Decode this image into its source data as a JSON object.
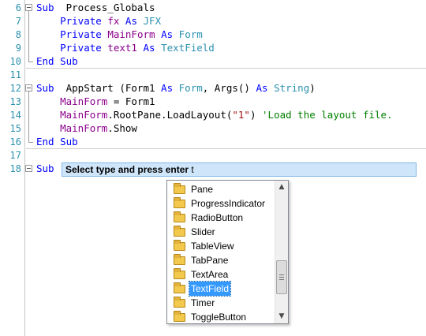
{
  "editor": {
    "lines": [
      {
        "num": "6",
        "tokens": [
          [
            "kw",
            "Sub"
          ],
          [
            "",
            "  Process_Globals"
          ]
        ]
      },
      {
        "num": "7",
        "tokens": [
          [
            "",
            "    "
          ],
          [
            "kw",
            "Private"
          ],
          [
            "",
            " "
          ],
          [
            "mf",
            "fx"
          ],
          [
            "",
            " "
          ],
          [
            "kw",
            "As"
          ],
          [
            "",
            " "
          ],
          [
            "tp",
            "JFX"
          ]
        ]
      },
      {
        "num": "8",
        "tokens": [
          [
            "",
            "    "
          ],
          [
            "kw",
            "Private"
          ],
          [
            "",
            " "
          ],
          [
            "mf",
            "MainForm"
          ],
          [
            "",
            " "
          ],
          [
            "kw",
            "As"
          ],
          [
            "",
            " "
          ],
          [
            "tp",
            "Form"
          ]
        ]
      },
      {
        "num": "9",
        "tokens": [
          [
            "",
            "    "
          ],
          [
            "kw",
            "Private"
          ],
          [
            "",
            " "
          ],
          [
            "mf",
            "text1"
          ],
          [
            "",
            " "
          ],
          [
            "kw",
            "As"
          ],
          [
            "",
            " "
          ],
          [
            "tp",
            "TextField"
          ]
        ]
      },
      {
        "num": "10",
        "tokens": [
          [
            "kw",
            "End Sub"
          ]
        ]
      },
      {
        "num": "11",
        "tokens": []
      },
      {
        "num": "12",
        "tokens": [
          [
            "kw",
            "Sub"
          ],
          [
            "",
            "  AppStart (Form1 "
          ],
          [
            "kw",
            "As"
          ],
          [
            "",
            " "
          ],
          [
            "tp",
            "Form"
          ],
          [
            "",
            ", Args() "
          ],
          [
            "kw",
            "As"
          ],
          [
            "",
            " "
          ],
          [
            "tp",
            "String"
          ],
          [
            "",
            ")"
          ]
        ]
      },
      {
        "num": "13",
        "tokens": [
          [
            "",
            "    "
          ],
          [
            "mf",
            "MainForm"
          ],
          [
            "",
            " = Form1"
          ]
        ]
      },
      {
        "num": "14",
        "tokens": [
          [
            "",
            "    "
          ],
          [
            "mf",
            "MainForm"
          ],
          [
            "",
            ".RootPane.LoadLayout("
          ],
          [
            "str",
            "\"1\""
          ],
          [
            "",
            ") "
          ],
          [
            "cm",
            "'Load the layout file."
          ]
        ]
      },
      {
        "num": "15",
        "tokens": [
          [
            "",
            "    "
          ],
          [
            "mf",
            "MainForm"
          ],
          [
            "",
            ".Show"
          ]
        ]
      },
      {
        "num": "16",
        "tokens": [
          [
            "kw",
            "End Sub"
          ]
        ]
      },
      {
        "num": "17",
        "tokens": []
      },
      {
        "num": "18",
        "tokens": [
          [
            "kw",
            "Sub"
          ]
        ]
      }
    ]
  },
  "prompt": {
    "hint": "Select type and press enter",
    "typed": " t"
  },
  "autocomplete": {
    "items": [
      "Pane",
      "ProgressIndicator",
      "RadioButton",
      "Slider",
      "TableView",
      "TabPane",
      "TextArea",
      "TextField",
      "Timer",
      "ToggleButton"
    ],
    "selected": "TextField",
    "scroll_fraction": 0.75
  },
  "colors": {
    "keyword": "#0000ff",
    "type": "#2b91af",
    "member": "#8b008b",
    "string": "#a31515",
    "comment": "#008000",
    "selection": "#3399ff"
  }
}
